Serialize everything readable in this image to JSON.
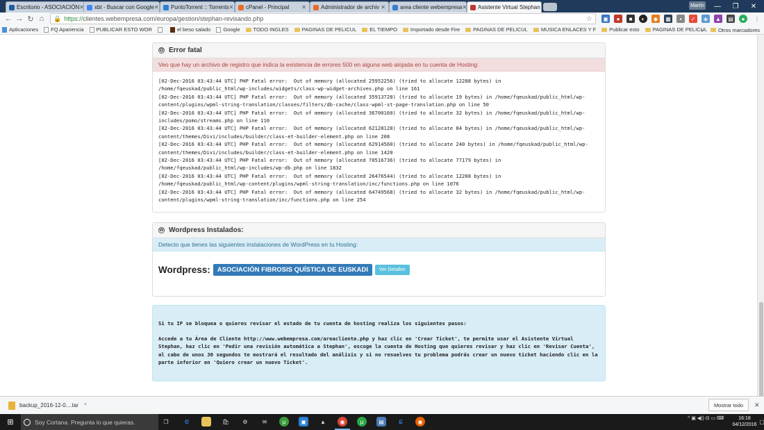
{
  "browser": {
    "tabs": [
      {
        "label": "Escritorio - ASOCIACIÓN",
        "fav": "#1e5fa0"
      },
      {
        "label": "xbt - Buscar con Google",
        "fav": "#4285f4"
      },
      {
        "label": "PuntoTorrent :: Torrents",
        "fav": "#2b7fd0"
      },
      {
        "label": "cPanel - Principal",
        "fav": "#e86c2a"
      },
      {
        "label": "Administrador de archiv",
        "fav": "#e86c2a"
      },
      {
        "label": "area cliente webempresa",
        "fav": "#3a7bd5"
      },
      {
        "label": "Asistente Virtual Stephan",
        "fav": "#c0392b"
      }
    ],
    "user_badge": "Martín",
    "url_proto": "https://",
    "url_rest": "clientes.webempresa.com/europa/gestion/stephan-revisando.php",
    "bookmarks": [
      {
        "label": "Aplicaciones",
        "kind": "apps"
      },
      {
        "label": "FQ Apariencia",
        "kind": "page"
      },
      {
        "label": "PUBLICAR ESTO WOR",
        "kind": "page"
      },
      {
        "label": "",
        "kind": "page"
      },
      {
        "label": "el beso salado",
        "kind": "page"
      },
      {
        "label": "Google",
        "kind": "page"
      },
      {
        "label": "TODO INGLES",
        "kind": "folder"
      },
      {
        "label": "PAGINAS DE PELICUL",
        "kind": "folder"
      },
      {
        "label": "EL TIEMPO",
        "kind": "folder"
      },
      {
        "label": "Importado desde Fire",
        "kind": "folder"
      },
      {
        "label": "PAGINAS DE PELICUL",
        "kind": "folder"
      },
      {
        "label": "MUSICA ENLACES Y F",
        "kind": "folder"
      },
      {
        "label": "Publicar esto",
        "kind": "folder"
      },
      {
        "label": "PAGINAS DE PELICUL",
        "kind": "folder"
      }
    ],
    "bookmarks_more": "»",
    "other_bookmarks": "Otros marcadores"
  },
  "error_panel": {
    "title": "Error fatal",
    "alert": "Veo que hay un archivo de registro que indica la existencia de errores 500 en alguna web alojada en tu cuenta de Hosting:",
    "log": "[02-Dec-2016 03:43:44 UTC] PHP Fatal error:  Out of memory (allocated 25952256) (tried to allocate 12288 bytes) in\n/home/fqeuskad/public_html/wp-includes/widgets/class-wp-widget-archives.php on line 161\n[02-Dec-2016 03:43:44 UTC] PHP Fatal error:  Out of memory (allocated 35913728) (tried to allocate 19 bytes) in /home/fqeuskad/public_html/wp-\ncontent/plugins/wpml-string-translation/classes/filters/db-cache/class-wpml-st-page-translation.php on line 50\n[02-Dec-2016 03:43:44 UTC] PHP Fatal error:  Out of memory (allocated 36700160) (tried to allocate 32 bytes) in /home/fqeuskad/public_html/wp-\nincludes/pomo/streams.php on line 110\n[02-Dec-2016 03:43:44 UTC] PHP Fatal error:  Out of memory (allocated 62128128) (tried to allocate 84 bytes) in /home/fqeuskad/public_html/wp-\ncontent/themes/Divi/includes/builder/class-et-builder-element.php on line 208\n[02-Dec-2016 03:43:44 UTC] PHP Fatal error:  Out of memory (allocated 62914560) (tried to allocate 240 bytes) in /home/fqeuskad/public_html/wp-\ncontent/themes/Divi/includes/builder/class-et-builder-element.php on line 1420\n[02-Dec-2016 03:43:44 UTC] PHP Fatal error:  Out of memory (allocated 70516736) (tried to allocate 77179 bytes) in\n/home/fqeuskad/public_html/wp-includes/wp-db.php on line 1832\n[02-Dec-2016 03:43:44 UTC] PHP Fatal error:  Out of memory (allocated 26476544) (tried to allocate 12288 bytes) in\n/home/fqeuskad/public_html/wp-content/plugins/wpml-string-translation/inc/functions.php on line 1076\n[02-Dec-2016 03:43:44 UTC] PHP Fatal error:  Out of memory (allocated 64749568) (tried to allocate 32 bytes) in /home/fqeuskad/public_html/wp-\ncontent/plugins/wpml-string-translation/inc/functions.php on line 254"
  },
  "wp_panel": {
    "title": "Wordpress Instalados:",
    "alert": "Detecto que tienes las siguientes instalaciones de WordPress en tu Hosting:",
    "label": "Wordpress:",
    "site": "ASOCIACIÓN FIBROSIS QUÍSTICA DE EUSKADI",
    "details_button": "Ver Detalles"
  },
  "info_box": {
    "line1": "Si tu IP se bloquea o quieres revisar el estado de tu cuenta de hosting realiza los siguientes pasos:",
    "line2": "Accede a tu Área de Cliente http://www.webempresa.com/areacliente.php y haz clic en 'Crear Ticket', te permite usar el Asistente Virtual Stephan, haz clic en 'Pedir una revisión automática a Stephan', escoge la cuenta de Hosting que quieres revisar y haz clic en 'Revisar Cuenta', al cabo de unos 30 segundos te mostrará el resultado del análisis y si no resuelves tu problema podrás crear un nuevo ticket haciendo clic en la parte inferior en 'Quiero crear un nuevo Ticket'."
  },
  "downloads": {
    "file": "backup_2016-12-0....tar",
    "show_all": "Mostrar todo"
  },
  "taskbar": {
    "cortana": "Soy Cortana. Pregunta lo que quieras.",
    "time": "16:18",
    "date": "04/12/2016"
  }
}
